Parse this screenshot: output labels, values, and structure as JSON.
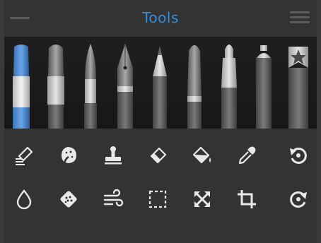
{
  "header": {
    "title": "Tools",
    "title_color": "#2f8fe0"
  },
  "brushes": [
    {
      "name": "marker",
      "selected": true
    },
    {
      "name": "flat-brush",
      "selected": false
    },
    {
      "name": "round-brush",
      "selected": false
    },
    {
      "name": "ink-pen",
      "selected": false
    },
    {
      "name": "pencil",
      "selected": false
    },
    {
      "name": "oil-brush",
      "selected": false
    },
    {
      "name": "felt-pen",
      "selected": false
    },
    {
      "name": "spray-can",
      "selected": false
    },
    {
      "name": "favorites",
      "selected": false
    }
  ],
  "tools_row1": [
    "smudge-icon",
    "texture-brush-icon",
    "stamp-icon",
    "eraser-icon",
    "fill-bucket-icon",
    "eyedropper-icon",
    "undo-icon"
  ],
  "tools_row2": [
    "water-drop-icon",
    "sponge-icon",
    "blur-wind-icon",
    "selection-icon",
    "transform-icon",
    "crop-icon",
    "redo-icon"
  ],
  "colors": {
    "accent": "#2f8fe0",
    "icon": "#e8e8e8",
    "panel": "#333333",
    "strip": "#1a1a1a"
  }
}
